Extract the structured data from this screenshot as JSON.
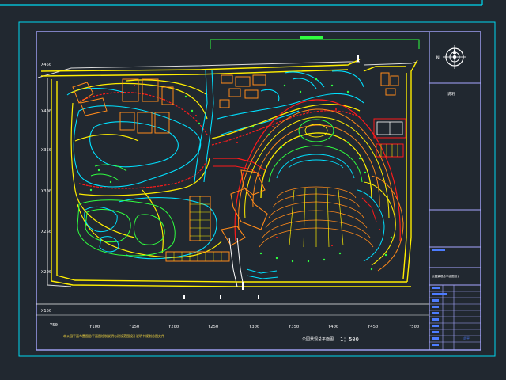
{
  "drawing": {
    "scale_text": "1：500",
    "bottom_note": "本公园平面布置图总平面图绘制说明与建设范围设计说明书规划总图文件",
    "plan_title": "公园景观总平面图"
  },
  "axis": {
    "y_labels": [
      "X450",
      "X400",
      "X350",
      "X300",
      "X250",
      "X200",
      "X150"
    ],
    "x_labels": [
      "Y50",
      "Y100",
      "Y150",
      "Y200",
      "Y250",
      "Y300",
      "Y350",
      "Y400",
      "Y450",
      "Y500"
    ]
  },
  "title_block": {
    "north_label": "N",
    "note_label": "说明",
    "project_name": "公园景观总平面图设计",
    "drawing_no": "总平"
  },
  "colors": {
    "background": "#212830",
    "frame_cyan": "#00d8f0",
    "frame_purple": "#a0a0ff",
    "path_yellow": "#ffee00",
    "water_cyan": "#00e0ff",
    "road_red": "#ff1a1a",
    "building_orange": "#ff8a1a",
    "green_plant": "#30ff40"
  }
}
